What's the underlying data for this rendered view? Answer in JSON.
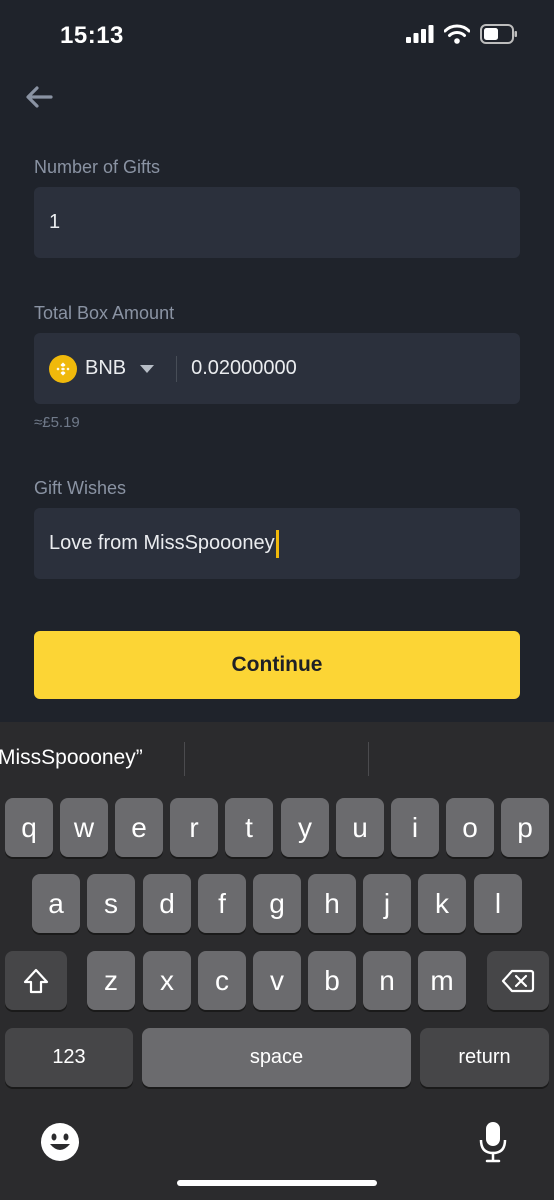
{
  "status_bar": {
    "time": "15:13"
  },
  "form": {
    "gifts_label": "Number of Gifts",
    "gifts_value": "1",
    "amount_label": "Total Box Amount",
    "coin": "BNB",
    "amount_value": "0.02000000",
    "fiat_estimate": "≈£5.19",
    "wishes_label": "Gift Wishes",
    "wishes_value": "Love from MissSpoooney"
  },
  "continue_label": "Continue",
  "keyboard": {
    "suggestion": "MissSpoooney”",
    "row1": [
      "q",
      "w",
      "e",
      "r",
      "t",
      "y",
      "u",
      "i",
      "o",
      "p"
    ],
    "row2": [
      "a",
      "s",
      "d",
      "f",
      "g",
      "h",
      "j",
      "k",
      "l"
    ],
    "row3": [
      "z",
      "x",
      "c",
      "v",
      "b",
      "n",
      "m"
    ],
    "numbers_label": "123",
    "space_label": "space",
    "return_label": "return"
  },
  "colors": {
    "accent": "#fcd535",
    "background": "#1f232b",
    "field": "#2b303c",
    "bnb": "#f0b90b"
  }
}
